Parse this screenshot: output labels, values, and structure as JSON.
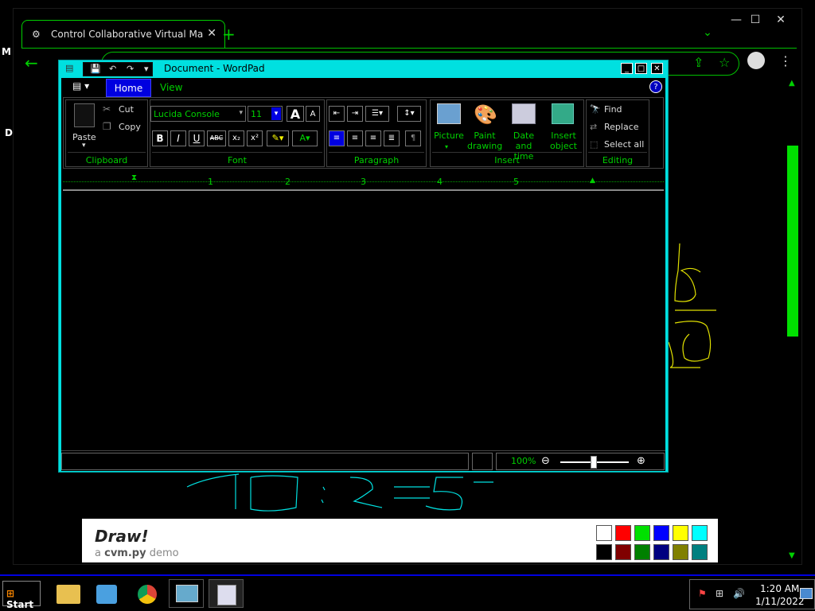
{
  "browser": {
    "tab_title": "Control Collaborative Virtual Ma",
    "new_tab": "+",
    "tab_close": "✕",
    "side_chars": [
      "M",
      "D"
    ]
  },
  "wordpad": {
    "title": "Document - WordPad",
    "tabs": {
      "home": "Home",
      "view": "View"
    },
    "clipboard": {
      "paste": "Paste",
      "cut": "Cut",
      "copy": "Copy",
      "label": "Clipboard"
    },
    "font": {
      "family": "Lucida Console",
      "size": "11",
      "label": "Font",
      "bold": "B",
      "italic": "I",
      "underline": "U",
      "strike": "ABC",
      "subscript": "x₂",
      "superscript": "x²",
      "grow": "A",
      "shrink": "A"
    },
    "paragraph": {
      "label": "Paragraph"
    },
    "insert": {
      "picture": "Picture",
      "paint1": "Paint",
      "paint2": "drawing",
      "date1": "Date and",
      "date2": "time",
      "obj1": "Insert",
      "obj2": "object",
      "label": "Insert"
    },
    "editing": {
      "find": "Find",
      "replace": "Replace",
      "select_all": "Select all",
      "label": "Editing"
    },
    "ruler": [
      "1",
      "2",
      "3",
      "4",
      "5"
    ],
    "zoom": "100%"
  },
  "banner": {
    "title": "Draw!",
    "sub_prefix": "a ",
    "sub_bold": "cvm.py",
    "sub_suffix": " demo",
    "colors_top": [
      "#ffffff",
      "#ff0000",
      "#00e000",
      "#0000ff",
      "#ffff00",
      "#00ffff"
    ],
    "colors_bottom": [
      "#000000",
      "#800000",
      "#008000",
      "#000080",
      "#808000",
      "#008080"
    ]
  },
  "taskbar": {
    "start": "Start",
    "time": "1:20 AM",
    "date": "1/11/2022"
  }
}
